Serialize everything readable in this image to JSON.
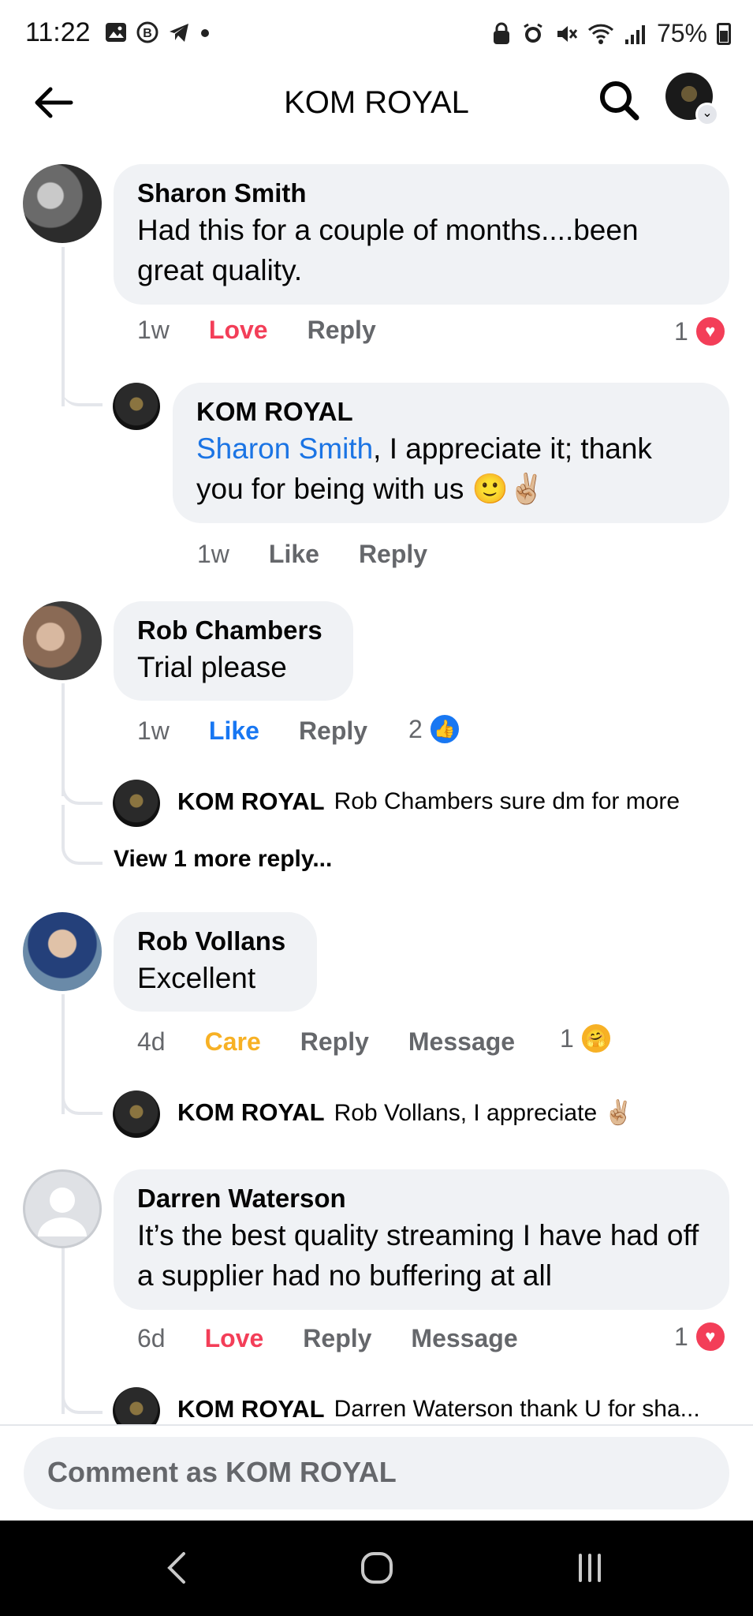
{
  "status_bar": {
    "time": "11:22",
    "battery": "75%"
  },
  "header": {
    "title": "KOM ROYAL"
  },
  "comments": [
    {
      "name": "Sharon Smith",
      "text": "Had this for a couple of months....been great quality.",
      "time": "1w",
      "reaction_label": "Love",
      "reply_label": "Reply",
      "reaction_count": "1",
      "reply": {
        "name": "KOM ROYAL",
        "mention": "Sharon Smith",
        "text": ", I appreciate it; thank you for being with us 🙂✌🏼",
        "time": "1w",
        "like_label": "Like",
        "reply_label": "Reply"
      }
    },
    {
      "name": "Rob Chambers",
      "text": "Trial please",
      "time": "1w",
      "reaction_label": "Like",
      "reply_label": "Reply",
      "reaction_count": "2",
      "reply": {
        "name": "KOM ROYAL",
        "text": "Rob Chambers sure dm for more"
      },
      "view_more": "View 1 more reply..."
    },
    {
      "name": "Rob Vollans",
      "text": "Excellent",
      "time": "4d",
      "reaction_label": "Care",
      "reply_label": "Reply",
      "message_label": "Message",
      "reaction_count": "1",
      "reply": {
        "name": "KOM ROYAL",
        "text": "Rob Vollans, I appreciate ✌🏼"
      }
    },
    {
      "name": "Darren Waterson",
      "text": "It’s the best quality streaming I have had off a supplier had no buffering at all",
      "time": "6d",
      "reaction_label": "Love",
      "reply_label": "Reply",
      "message_label": "Message",
      "reaction_count": "1",
      "reply": {
        "name": "KOM ROYAL",
        "text": "Darren Waterson thank U for sha..."
      }
    }
  ],
  "composer": {
    "placeholder": "Comment as KOM ROYAL"
  },
  "colors": {
    "love": "#f33e58",
    "like": "#1877f2",
    "care": "#f7b125",
    "bubble": "#f0f2f5",
    "secondary_text": "#65676b"
  }
}
